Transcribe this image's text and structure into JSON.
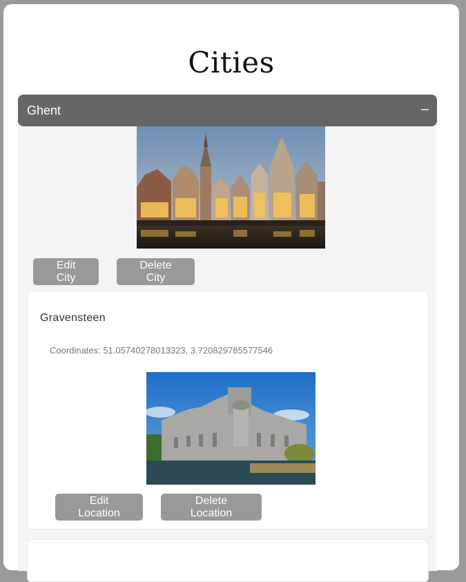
{
  "page": {
    "title": "Cities"
  },
  "city": {
    "name": "Ghent",
    "collapse_symbol": "–",
    "image_icon": "ghent-skyline-photo",
    "edit_label": "Edit City",
    "delete_label": "Delete City"
  },
  "location": {
    "name": "Gravensteen",
    "coordinates_text": "Coordinates: 51.05740278013323, 3.720829785577546",
    "image_icon": "gravensteen-castle-photo",
    "edit_label": "Edit Location",
    "delete_label": "Delete Location"
  },
  "colors": {
    "header_bg": "#666666",
    "button_bg": "#999999",
    "panel_bg": "#f4f4f4"
  }
}
